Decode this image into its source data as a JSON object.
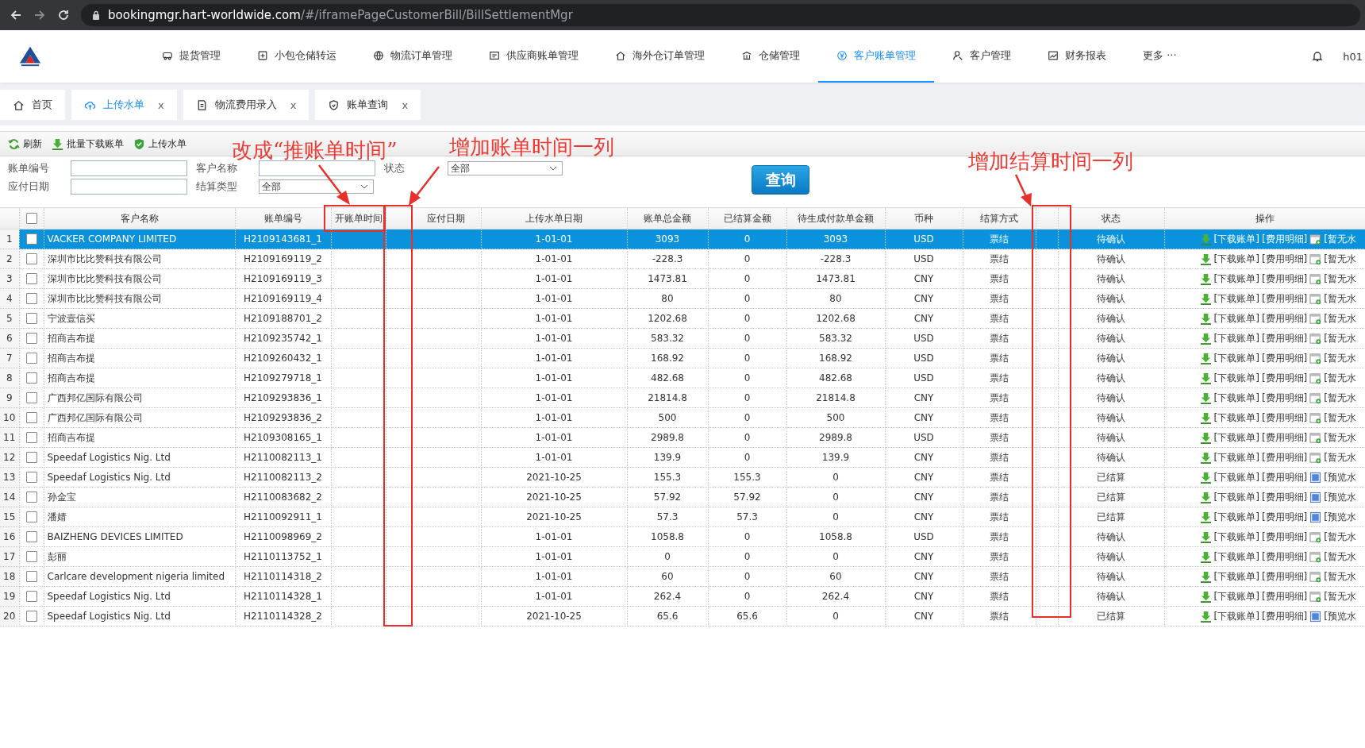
{
  "browser": {
    "url_host": "bookingmgr.hart-worldwide.com",
    "url_path": "/#/iframePageCustomerBill/BillSettlementMgr"
  },
  "nav": [
    {
      "label": "提货管理",
      "selected": false
    },
    {
      "label": "小包仓储转运",
      "selected": false
    },
    {
      "label": "物流订单管理",
      "selected": false
    },
    {
      "label": "供应商账单管理",
      "selected": false
    },
    {
      "label": "海外仓订单管理",
      "selected": false
    },
    {
      "label": "仓储管理",
      "selected": false
    },
    {
      "label": "客户账单管理",
      "selected": true
    },
    {
      "label": "客户管理",
      "selected": false
    },
    {
      "label": "财务报表",
      "selected": false
    },
    {
      "label": "更多 ···",
      "selected": false
    }
  ],
  "user": "h01",
  "tabs": [
    {
      "label": "首页",
      "selected": false
    },
    {
      "label": "上传水单",
      "selected": true,
      "close": "x"
    },
    {
      "label": "物流费用录入",
      "selected": false,
      "close": "x"
    },
    {
      "label": "账单查询",
      "selected": false,
      "close": "x"
    }
  ],
  "toolbar": [
    "刷新",
    "批量下载账单",
    "上传水单"
  ],
  "filters": {
    "bill_no": {
      "label": "账单编号"
    },
    "customer": {
      "label": "客户名称"
    },
    "status": {
      "label": "状态",
      "value": "全部"
    },
    "due_date": {
      "label": "应付日期"
    },
    "settle_type": {
      "label": "结算类型",
      "value": "全部"
    },
    "query": "查询"
  },
  "table": {
    "header_checkbox": {
      "checked": false
    },
    "columns": [
      {
        "label": "客户名称"
      },
      {
        "label": "账单编号"
      },
      {
        "label": "开账单时间"
      },
      {
        "label": "应付日期"
      },
      {
        "label": "上传水单日期"
      },
      {
        "label": "账单总金额"
      },
      {
        "label": "已结算金额"
      },
      {
        "label": "待生成付款单金额"
      },
      {
        "label": "币种"
      },
      {
        "label": "结算方式"
      },
      {
        "label": "状态"
      },
      {
        "label": "操作"
      }
    ],
    "rows": [
      {
        "no": "1",
        "selected": true,
        "checked": false,
        "customer": "VACKER COMPANY LIMITED",
        "bill_no": "H2109143681_1",
        "upload_date": "1-01-01",
        "total": "3093",
        "settled": "0",
        "pending": "3093",
        "currency": "USD",
        "method": "票结",
        "status": "待确认",
        "actions": [
          "[下载账单]",
          "[费用明细]"
        ],
        "receipt": {
          "kind": "none",
          "label": "[暂无水"
        }
      },
      {
        "no": "2",
        "selected": false,
        "checked": false,
        "customer": "深圳市比比赞科技有限公司",
        "bill_no": "H2109169119_2",
        "upload_date": "1-01-01",
        "total": "-228.3",
        "settled": "0",
        "pending": "-228.3",
        "currency": "USD",
        "method": "票结",
        "status": "待确认",
        "actions": [
          "[下载账单]",
          "[费用明细]"
        ],
        "receipt": {
          "kind": "none",
          "label": "[暂无水"
        }
      },
      {
        "no": "3",
        "selected": false,
        "checked": false,
        "customer": "深圳市比比赞科技有限公司",
        "bill_no": "H2109169119_3",
        "upload_date": "1-01-01",
        "total": "1473.81",
        "settled": "0",
        "pending": "1473.81",
        "currency": "CNY",
        "method": "票结",
        "status": "待确认",
        "actions": [
          "[下载账单]",
          "[费用明细]"
        ],
        "receipt": {
          "kind": "none",
          "label": "[暂无水"
        }
      },
      {
        "no": "4",
        "selected": false,
        "checked": false,
        "customer": "深圳市比比赞科技有限公司",
        "bill_no": "H2109169119_4",
        "upload_date": "1-01-01",
        "total": "80",
        "settled": "0",
        "pending": "80",
        "currency": "CNY",
        "method": "票结",
        "status": "待确认",
        "actions": [
          "[下载账单]",
          "[费用明细]"
        ],
        "receipt": {
          "kind": "none",
          "label": "[暂无水"
        }
      },
      {
        "no": "5",
        "selected": false,
        "checked": false,
        "customer": "宁波壹信买",
        "bill_no": "H2109188701_2",
        "upload_date": "1-01-01",
        "total": "1202.68",
        "settled": "0",
        "pending": "1202.68",
        "currency": "CNY",
        "method": "票结",
        "status": "待确认",
        "actions": [
          "[下载账单]",
          "[费用明细]"
        ],
        "receipt": {
          "kind": "none",
          "label": "[暂无水"
        }
      },
      {
        "no": "6",
        "selected": false,
        "checked": false,
        "customer": "招商吉布提",
        "bill_no": "H2109235742_1",
        "upload_date": "1-01-01",
        "total": "583.32",
        "settled": "0",
        "pending": "583.32",
        "currency": "USD",
        "method": "票结",
        "status": "待确认",
        "actions": [
          "[下载账单]",
          "[费用明细]"
        ],
        "receipt": {
          "kind": "none",
          "label": "[暂无水"
        }
      },
      {
        "no": "7",
        "selected": false,
        "checked": false,
        "customer": "招商吉布提",
        "bill_no": "H2109260432_1",
        "upload_date": "1-01-01",
        "total": "168.92",
        "settled": "0",
        "pending": "168.92",
        "currency": "USD",
        "method": "票结",
        "status": "待确认",
        "actions": [
          "[下载账单]",
          "[费用明细]"
        ],
        "receipt": {
          "kind": "none",
          "label": "[暂无水"
        }
      },
      {
        "no": "8",
        "selected": false,
        "checked": false,
        "customer": "招商吉布提",
        "bill_no": "H2109279718_1",
        "upload_date": "1-01-01",
        "total": "482.68",
        "settled": "0",
        "pending": "482.68",
        "currency": "USD",
        "method": "票结",
        "status": "待确认",
        "actions": [
          "[下载账单]",
          "[费用明细]"
        ],
        "receipt": {
          "kind": "none",
          "label": "[暂无水"
        }
      },
      {
        "no": "9",
        "selected": false,
        "checked": false,
        "customer": "广西邦亿国际有限公司",
        "bill_no": "H2109293836_1",
        "upload_date": "1-01-01",
        "total": "21814.8",
        "settled": "0",
        "pending": "21814.8",
        "currency": "CNY",
        "method": "票结",
        "status": "待确认",
        "actions": [
          "[下载账单]",
          "[费用明细]"
        ],
        "receipt": {
          "kind": "none",
          "label": "[暂无水"
        }
      },
      {
        "no": "10",
        "selected": false,
        "checked": false,
        "customer": "广西邦亿国际有限公司",
        "bill_no": "H2109293836_2",
        "upload_date": "1-01-01",
        "total": "500",
        "settled": "0",
        "pending": "500",
        "currency": "CNY",
        "method": "票结",
        "status": "待确认",
        "actions": [
          "[下载账单]",
          "[费用明细]"
        ],
        "receipt": {
          "kind": "none",
          "label": "[暂无水"
        }
      },
      {
        "no": "11",
        "selected": false,
        "checked": false,
        "customer": "招商吉布提",
        "bill_no": "H2109308165_1",
        "upload_date": "1-01-01",
        "total": "2989.8",
        "settled": "0",
        "pending": "2989.8",
        "currency": "USD",
        "method": "票结",
        "status": "待确认",
        "actions": [
          "[下载账单]",
          "[费用明细]"
        ],
        "receipt": {
          "kind": "none",
          "label": "[暂无水"
        }
      },
      {
        "no": "12",
        "selected": false,
        "checked": false,
        "customer": "Speedaf Logistics Nig. Ltd",
        "bill_no": "H2110082113_1",
        "upload_date": "1-01-01",
        "total": "139.9",
        "settled": "0",
        "pending": "139.9",
        "currency": "CNY",
        "method": "票结",
        "status": "待确认",
        "actions": [
          "[下载账单]",
          "[费用明细]"
        ],
        "receipt": {
          "kind": "none",
          "label": "[暂无水"
        }
      },
      {
        "no": "13",
        "selected": false,
        "checked": false,
        "customer": "Speedaf Logistics Nig. Ltd",
        "bill_no": "H2110082113_2",
        "upload_date": "2021-10-25",
        "total": "155.3",
        "settled": "155.3",
        "pending": "0",
        "currency": "CNY",
        "method": "票结",
        "status": "已结算",
        "actions": [
          "[下载账单]",
          "[费用明细]"
        ],
        "receipt": {
          "kind": "preview",
          "label": "[预览水"
        }
      },
      {
        "no": "14",
        "selected": false,
        "checked": false,
        "customer": "孙金宝",
        "bill_no": "H2110083682_2",
        "upload_date": "2021-10-25",
        "total": "57.92",
        "settled": "57.92",
        "pending": "0",
        "currency": "CNY",
        "method": "票结",
        "status": "已结算",
        "actions": [
          "[下载账单]",
          "[费用明细]"
        ],
        "receipt": {
          "kind": "preview",
          "label": "[预览水"
        }
      },
      {
        "no": "15",
        "selected": false,
        "checked": false,
        "customer": "潘婧",
        "bill_no": "H2110092911_1",
        "upload_date": "2021-10-25",
        "total": "57.3",
        "settled": "57.3",
        "pending": "0",
        "currency": "CNY",
        "method": "票结",
        "status": "已结算",
        "actions": [
          "[下载账单]",
          "[费用明细]"
        ],
        "receipt": {
          "kind": "preview",
          "label": "[预览水"
        }
      },
      {
        "no": "16",
        "selected": false,
        "checked": false,
        "customer": "BAIZHENG DEVICES LIMITED",
        "bill_no": "H2110098969_2",
        "upload_date": "1-01-01",
        "total": "1058.8",
        "settled": "0",
        "pending": "1058.8",
        "currency": "USD",
        "method": "票结",
        "status": "待确认",
        "actions": [
          "[下载账单]",
          "[费用明细]"
        ],
        "receipt": {
          "kind": "none",
          "label": "[暂无水"
        }
      },
      {
        "no": "17",
        "selected": false,
        "checked": false,
        "customer": "彭丽",
        "bill_no": "H2110113752_1",
        "upload_date": "1-01-01",
        "total": "0",
        "settled": "0",
        "pending": "0",
        "currency": "CNY",
        "method": "票结",
        "status": "待确认",
        "actions": [
          "[下载账单]",
          "[费用明细]"
        ],
        "receipt": {
          "kind": "none",
          "label": "[暂无水"
        }
      },
      {
        "no": "18",
        "selected": false,
        "checked": false,
        "customer": "Carlcare development nigeria limited",
        "bill_no": "H2110114318_2",
        "upload_date": "1-01-01",
        "total": "60",
        "settled": "0",
        "pending": "60",
        "currency": "CNY",
        "method": "票结",
        "status": "待确认",
        "actions": [
          "[下载账单]",
          "[费用明细]"
        ],
        "receipt": {
          "kind": "none",
          "label": "[暂无水"
        }
      },
      {
        "no": "19",
        "selected": false,
        "checked": false,
        "customer": "Speedaf Logistics Nig. Ltd",
        "bill_no": "H2110114328_1",
        "upload_date": "1-01-01",
        "total": "262.4",
        "settled": "0",
        "pending": "262.4",
        "currency": "CNY",
        "method": "票结",
        "status": "待确认",
        "actions": [
          "[下载账单]",
          "[费用明细]"
        ],
        "receipt": {
          "kind": "none",
          "label": "[暂无水"
        }
      },
      {
        "no": "20",
        "selected": false,
        "checked": false,
        "customer": "Speedaf Logistics Nig. Ltd",
        "bill_no": "H2110114328_2",
        "upload_date": "2021-10-25",
        "total": "65.6",
        "settled": "65.6",
        "pending": "0",
        "currency": "CNY",
        "method": "票结",
        "status": "已结算",
        "actions": [
          "[下载账单]",
          "[费用明细]"
        ],
        "receipt": {
          "kind": "preview",
          "label": "[预览水"
        }
      }
    ]
  },
  "annotations": [
    "改成“推账单时间”",
    "增加账单时间一列",
    "增加结算时间一列"
  ]
}
